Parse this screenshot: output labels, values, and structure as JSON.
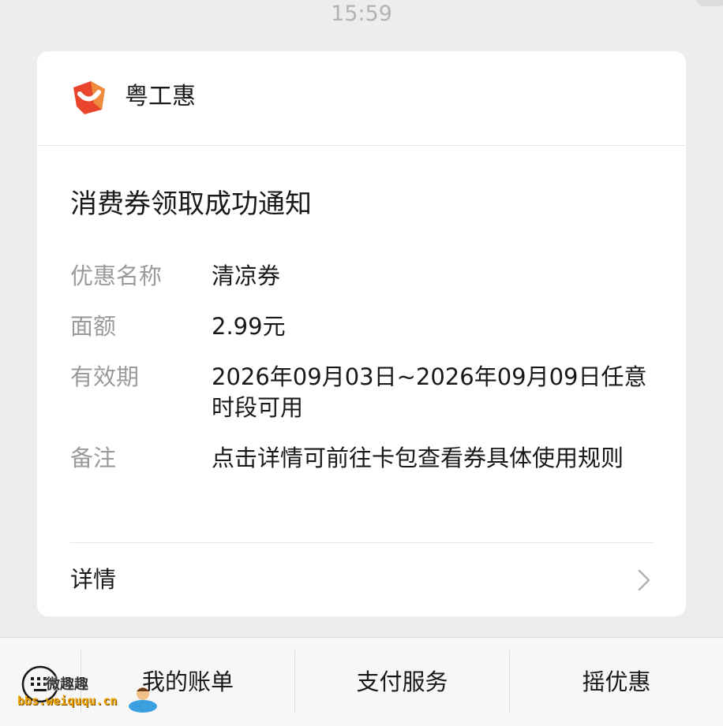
{
  "chat": {
    "timestamp": "15:59"
  },
  "card": {
    "brand": {
      "name": "粤工惠",
      "logo_icon": "yuegonghui-logo-icon",
      "logo_colors": [
        "#e8452c",
        "#f08a3c"
      ]
    },
    "title": "消费券领取成功通知",
    "fields": [
      {
        "label": "优惠名称",
        "value": "清凉券"
      },
      {
        "label": "面额",
        "value": "2.99元"
      },
      {
        "label": "有效期",
        "value": "2026年09月03日~2026年09月09日任意时段可用"
      },
      {
        "label": "备注",
        "value": "点击详情可前往卡包查看券具体使用规则"
      }
    ],
    "detail": {
      "label": "详情",
      "icon": "chevron-right-icon"
    }
  },
  "bottom_menu": {
    "toggle_icon": "keyboard-icon",
    "items": [
      {
        "label": "我的账单"
      },
      {
        "label": "支付服务"
      },
      {
        "label": "摇优惠"
      }
    ]
  },
  "watermark": {
    "title": "微趣趣",
    "url": "bbs.weiququ.cn"
  }
}
